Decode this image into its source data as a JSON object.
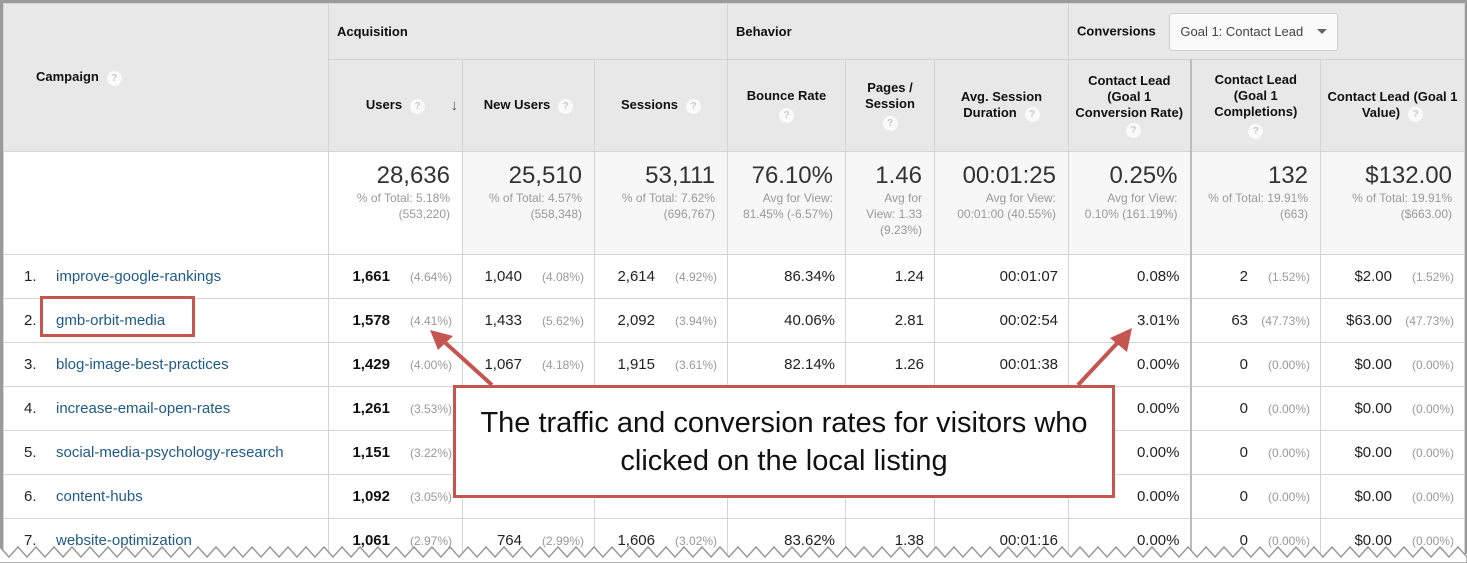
{
  "header": {
    "campaign_label": "Campaign",
    "groups": {
      "acquisition": "Acquisition",
      "behavior": "Behavior",
      "conversions": "Conversions"
    },
    "goal_dropdown": {
      "selected": "Goal 1: Contact Lead"
    },
    "columns": {
      "users": "Users",
      "new_users": "New Users",
      "sessions": "Sessions",
      "bounce_rate": "Bounce Rate",
      "pages_session": "Pages / Session",
      "avg_session_duration": "Avg. Session Duration",
      "conv_rate": "Contact Lead (Goal 1 Conversion Rate)",
      "completions": "Contact Lead (Goal 1 Completions)",
      "value": "Contact Lead (Goal 1 Value)"
    },
    "help_glyph": "?",
    "sort_glyph": "↓"
  },
  "totals": {
    "users": {
      "value": "28,636",
      "sub": "% of Total: 5.18% (553,220)"
    },
    "new_users": {
      "value": "25,510",
      "sub": "% of Total: 4.57% (558,348)"
    },
    "sessions": {
      "value": "53,111",
      "sub": "% of Total: 7.62% (696,767)"
    },
    "bounce_rate": {
      "value": "76.10%",
      "sub": "Avg for View: 81.45% (-6.57%)"
    },
    "pages_session": {
      "value": "1.46",
      "sub": "Avg for View: 1.33 (9.23%)"
    },
    "avg_session_duration": {
      "value": "00:01:25",
      "sub": "Avg for View: 00:01:00 (40.55%)"
    },
    "conv_rate": {
      "value": "0.25%",
      "sub": "Avg for View: 0.10% (161.19%)"
    },
    "completions": {
      "value": "132",
      "sub": "% of Total: 19.91% (663)"
    },
    "value": {
      "value": "$132.00",
      "sub": "% of Total: 19.91% ($663.00)"
    }
  },
  "rows": [
    {
      "idx": "1.",
      "campaign": "improve-google-rankings",
      "users": "1,661",
      "users_pct": "(4.64%)",
      "new_users": "1,040",
      "new_users_pct": "(4.08%)",
      "sessions": "2,614",
      "sessions_pct": "(4.92%)",
      "bounce": "86.34%",
      "pages": "1.24",
      "duration": "00:01:07",
      "conv": "0.08%",
      "comp": "2",
      "comp_pct": "(1.52%)",
      "val": "$2.00",
      "val_pct": "(1.52%)"
    },
    {
      "idx": "2.",
      "campaign": "gmb-orbit-media",
      "users": "1,578",
      "users_pct": "(4.41%)",
      "new_users": "1,433",
      "new_users_pct": "(5.62%)",
      "sessions": "2,092",
      "sessions_pct": "(3.94%)",
      "bounce": "40.06%",
      "pages": "2.81",
      "duration": "00:02:54",
      "conv": "3.01%",
      "comp": "63",
      "comp_pct": "(47.73%)",
      "val": "$63.00",
      "val_pct": "(47.73%)"
    },
    {
      "idx": "3.",
      "campaign": "blog-image-best-practices",
      "users": "1,429",
      "users_pct": "(4.00%)",
      "new_users": "1,067",
      "new_users_pct": "(4.18%)",
      "sessions": "1,915",
      "sessions_pct": "(3.61%)",
      "bounce": "82.14%",
      "pages": "1.26",
      "duration": "00:01:38",
      "conv": "0.00%",
      "comp": "0",
      "comp_pct": "(0.00%)",
      "val": "$0.00",
      "val_pct": "(0.00%)"
    },
    {
      "idx": "4.",
      "campaign": "increase-email-open-rates",
      "users": "1,261",
      "users_pct": "(3.53%)",
      "new_users": "",
      "new_users_pct": "",
      "sessions": "",
      "sessions_pct": "",
      "bounce": "",
      "pages": "",
      "duration": "",
      "conv": "0.00%",
      "comp": "0",
      "comp_pct": "(0.00%)",
      "val": "$0.00",
      "val_pct": "(0.00%)"
    },
    {
      "idx": "5.",
      "campaign": "social-media-psychology-research",
      "users": "1,151",
      "users_pct": "(3.22%)",
      "new_users": "",
      "new_users_pct": "",
      "sessions": "",
      "sessions_pct": "",
      "bounce": "",
      "pages": "",
      "duration": "",
      "conv": "0.00%",
      "comp": "0",
      "comp_pct": "(0.00%)",
      "val": "$0.00",
      "val_pct": "(0.00%)"
    },
    {
      "idx": "6.",
      "campaign": "content-hubs",
      "users": "1,092",
      "users_pct": "(3.05%)",
      "new_users": "",
      "new_users_pct": "",
      "sessions": "",
      "sessions_pct": "",
      "bounce": "",
      "pages": "",
      "duration": "",
      "conv": "0.00%",
      "comp": "0",
      "comp_pct": "(0.00%)",
      "val": "$0.00",
      "val_pct": "(0.00%)"
    },
    {
      "idx": "7.",
      "campaign": "website-optimization",
      "users": "1,061",
      "users_pct": "(2.97%)",
      "new_users": "764",
      "new_users_pct": "(2.99%)",
      "sessions": "1,606",
      "sessions_pct": "(3.02%)",
      "bounce": "83.62%",
      "pages": "1.38",
      "duration": "00:01:16",
      "conv": "0.00%",
      "comp": "0",
      "comp_pct": "(0.00%)",
      "val": "$0.00",
      "val_pct": "(0.00%)"
    }
  ],
  "annotation": {
    "callout_text": "The traffic and conversion rates for visitors who clicked on the local listing",
    "color": "#c5564f"
  }
}
